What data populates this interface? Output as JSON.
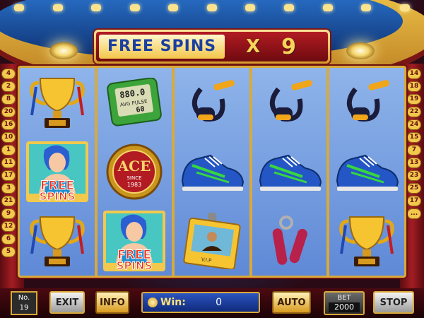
{
  "banner": {
    "label": "FREE SPINS",
    "multiplier": "X",
    "count": "9"
  },
  "paylines": {
    "left": [
      "4",
      "2",
      "8",
      "20",
      "16",
      "10",
      "1",
      "11",
      "17",
      "3",
      "21",
      "9",
      "12",
      "6",
      "5"
    ],
    "right": [
      "14",
      "18",
      "19",
      "22",
      "24",
      "15",
      "7",
      "13",
      "23",
      "25",
      "17",
      "..."
    ]
  },
  "reels": [
    [
      "trophy",
      "free-spins-woman",
      "trophy"
    ],
    [
      "pulse-meter",
      "ace-badge",
      "free-spins-woman"
    ],
    [
      "jump-rope",
      "sneaker",
      "vip-badge"
    ],
    [
      "jump-rope",
      "sneaker",
      "hand-grip"
    ],
    [
      "jump-rope",
      "sneaker",
      "trophy"
    ]
  ],
  "symbol_text": {
    "pulse_meter": {
      "top": "88",
      "mid": "0.0",
      "label": "AVG PULSE",
      "bottom": "60"
    },
    "ace": {
      "word": "ACE",
      "since": "SINCE",
      "year": "1983"
    },
    "vip": "V.I.P",
    "free_spins": {
      "line1": "FREE",
      "line2": "SPINS"
    }
  },
  "bottom": {
    "no_label": "No.",
    "no_value": "19",
    "exit": "EXIT",
    "info": "INFO",
    "win_label": "Win:",
    "win_value": "0",
    "auto": "AUTO",
    "bet_label": "BET",
    "bet_value": "2000",
    "stop": "STOP"
  }
}
